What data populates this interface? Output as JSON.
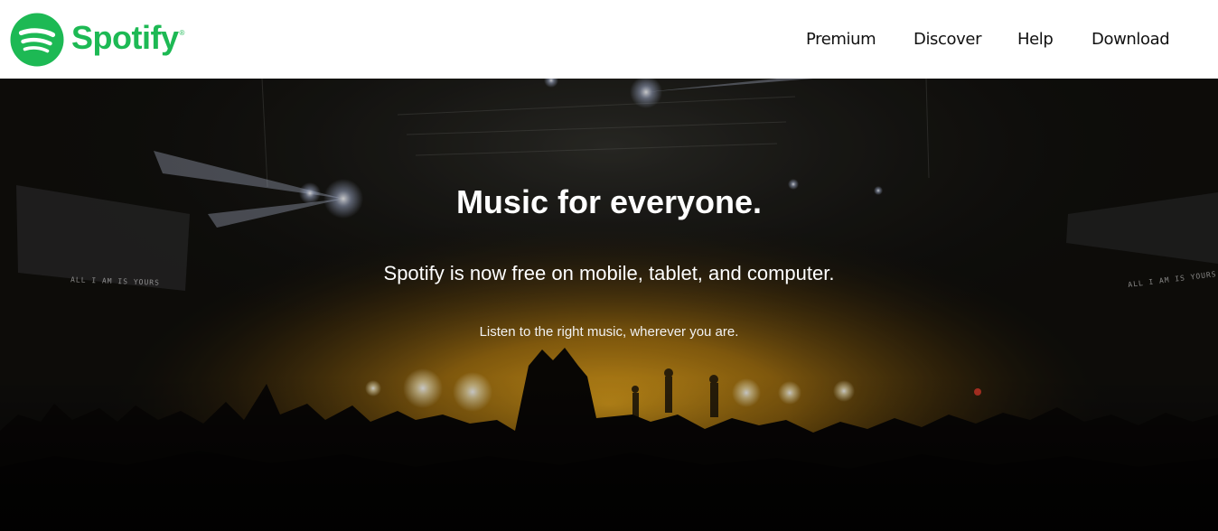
{
  "brand": {
    "name": "Spotify",
    "registered_mark": "®",
    "color": "#1db954"
  },
  "nav": {
    "items": [
      {
        "label": "Premium"
      },
      {
        "label": "Discover"
      },
      {
        "label": "Help"
      },
      {
        "label": "Download"
      }
    ]
  },
  "hero": {
    "title": "Music for everyone.",
    "subtitle": "Spotify is now free on mobile, tablet, and computer.",
    "tagline": "Listen to the right music, wherever you are.",
    "screen_left_text": "ALL I AM IS YOURS",
    "screen_right_text": "ALL I AM IS YOURS",
    "glow_color": "#f0a818"
  },
  "icons": {
    "logo": "spotify-logo-icon"
  }
}
